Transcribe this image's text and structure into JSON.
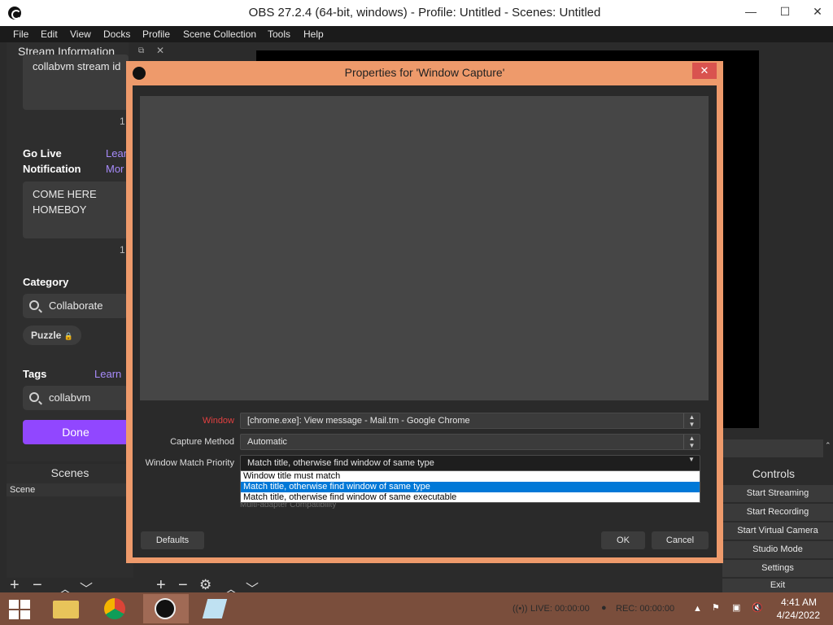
{
  "window": {
    "title": "OBS 27.2.4 (64-bit, windows) - Profile: Untitled - Scenes: Untitled",
    "minimize": "—",
    "maximize": "☐",
    "close": "✕"
  },
  "menu": [
    "File",
    "Edit",
    "View",
    "Docks",
    "Profile",
    "Scene Collection",
    "Tools",
    "Help"
  ],
  "stream_info": {
    "dock_title": "Stream Information",
    "title_value": "collabvm stream id",
    "title_count": "1",
    "go_live_label_1": "Go Live",
    "go_live_label_2": "Notification",
    "learn_more_1": "Lear",
    "learn_more_2": "Mor",
    "notification_value_1": "COME HERE",
    "notification_value_2": "HOMEBOY",
    "notification_count": "1",
    "category_label": "Category",
    "category_value": "Collaborate",
    "category_tag": "Puzzle",
    "tags_label": "Tags",
    "tags_learn": "Learn",
    "tags_value": "collabvm",
    "done_label": "Done"
  },
  "scenes": {
    "title": "Scenes",
    "items": [
      "Scene"
    ]
  },
  "controls": {
    "title": "Controls",
    "buttons": [
      "Start Streaming",
      "Start Recording",
      "Start Virtual Camera",
      "Studio Mode",
      "Settings",
      "Exit"
    ]
  },
  "dialog": {
    "title": "Properties for 'Window Capture'",
    "close": "✕",
    "window_label": "Window",
    "window_value": "[chrome.exe]: View message - Mail.tm - Google Chrome",
    "capture_label": "Capture Method",
    "capture_value": "Automatic",
    "priority_label": "Window Match Priority",
    "priority_value": "Match title, otherwise find window of same type",
    "options": [
      "Window title must match",
      "Match title, otherwise find window of same type",
      "Match title, otherwise find window of same executable"
    ],
    "hidden_checkbox": "Multi-adapter Compatibility",
    "defaults": "Defaults",
    "ok": "OK",
    "cancel": "Cancel"
  },
  "statusbar": {
    "live": "LIVE: 00:00:00",
    "rec": "REC: 00:00:00"
  },
  "taskbar": {
    "time": "4:41 AM",
    "date": "4/24/2022"
  },
  "colors": {
    "accent_purple": "#9147ff",
    "dialog_border": "#ee9a6b",
    "selection_blue": "#0078d7",
    "window_label_red": "#e04040"
  }
}
